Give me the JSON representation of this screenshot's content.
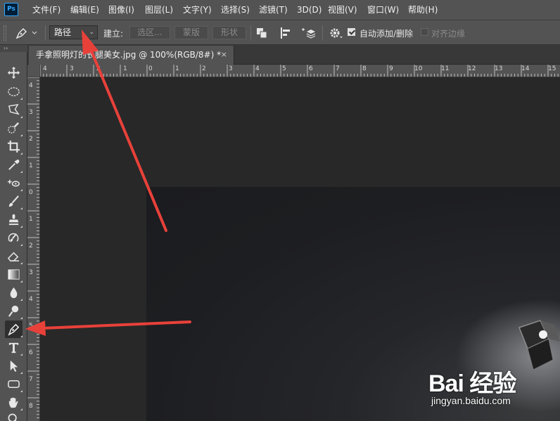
{
  "app": {
    "logo_text": "Ps"
  },
  "menu": [
    "文件(F)",
    "编辑(E)",
    "图像(I)",
    "图层(L)",
    "文字(Y)",
    "选择(S)",
    "滤镜(T)",
    "3D(D)",
    "视图(V)",
    "窗口(W)",
    "帮助(H)"
  ],
  "options_bar": {
    "tool_icon": "pen-icon",
    "mode_value": "路径",
    "make_label": "建立:",
    "selection_button": "选区...",
    "mask_button": "蒙版",
    "shape_button": "形状",
    "auto_add_delete_label": "自动添加/删除",
    "auto_add_delete_checked": true,
    "align_edges_label": "对齐边缘",
    "align_edges_checked": false
  },
  "document_tab": {
    "title": "手拿照明灯的长腿美女.jpg @ 100%(RGB/8#) *",
    "close_glyph": "×"
  },
  "toolbox": {
    "active_tool": "pen-tool",
    "tools": [
      "move-tool",
      "elliptical-marquee-tool",
      "polygonal-lasso-tool",
      "quick-selection-tool",
      "crop-tool",
      "eyedropper-tool",
      "spot-healing-brush-tool",
      "brush-tool",
      "clone-stamp-tool",
      "history-brush-tool",
      "eraser-tool",
      "gradient-tool",
      "blur-tool",
      "dodge-tool",
      "pen-tool",
      "type-tool",
      "path-selection-tool",
      "rectangle-tool",
      "hand-tool",
      "zoom-tool"
    ]
  },
  "rulers": {
    "horizontal_labels": [
      "4",
      "3",
      "2",
      "1",
      "0",
      "1",
      "2",
      "3",
      "4",
      "5",
      "6",
      "7",
      "8",
      "9",
      "10",
      "11",
      "12",
      "13",
      "14",
      "15"
    ],
    "vertical_labels": [
      "4",
      "3",
      "2",
      "1",
      "0",
      "1",
      "2",
      "3",
      "4",
      "5",
      "6",
      "7",
      "8"
    ]
  },
  "watermark": {
    "brand": "Bai 经验",
    "url": "jingyan.baidu.com"
  },
  "colors": {
    "annotation_arrow": "#e8413a",
    "panel": "#535353",
    "canvas": "#282828"
  }
}
